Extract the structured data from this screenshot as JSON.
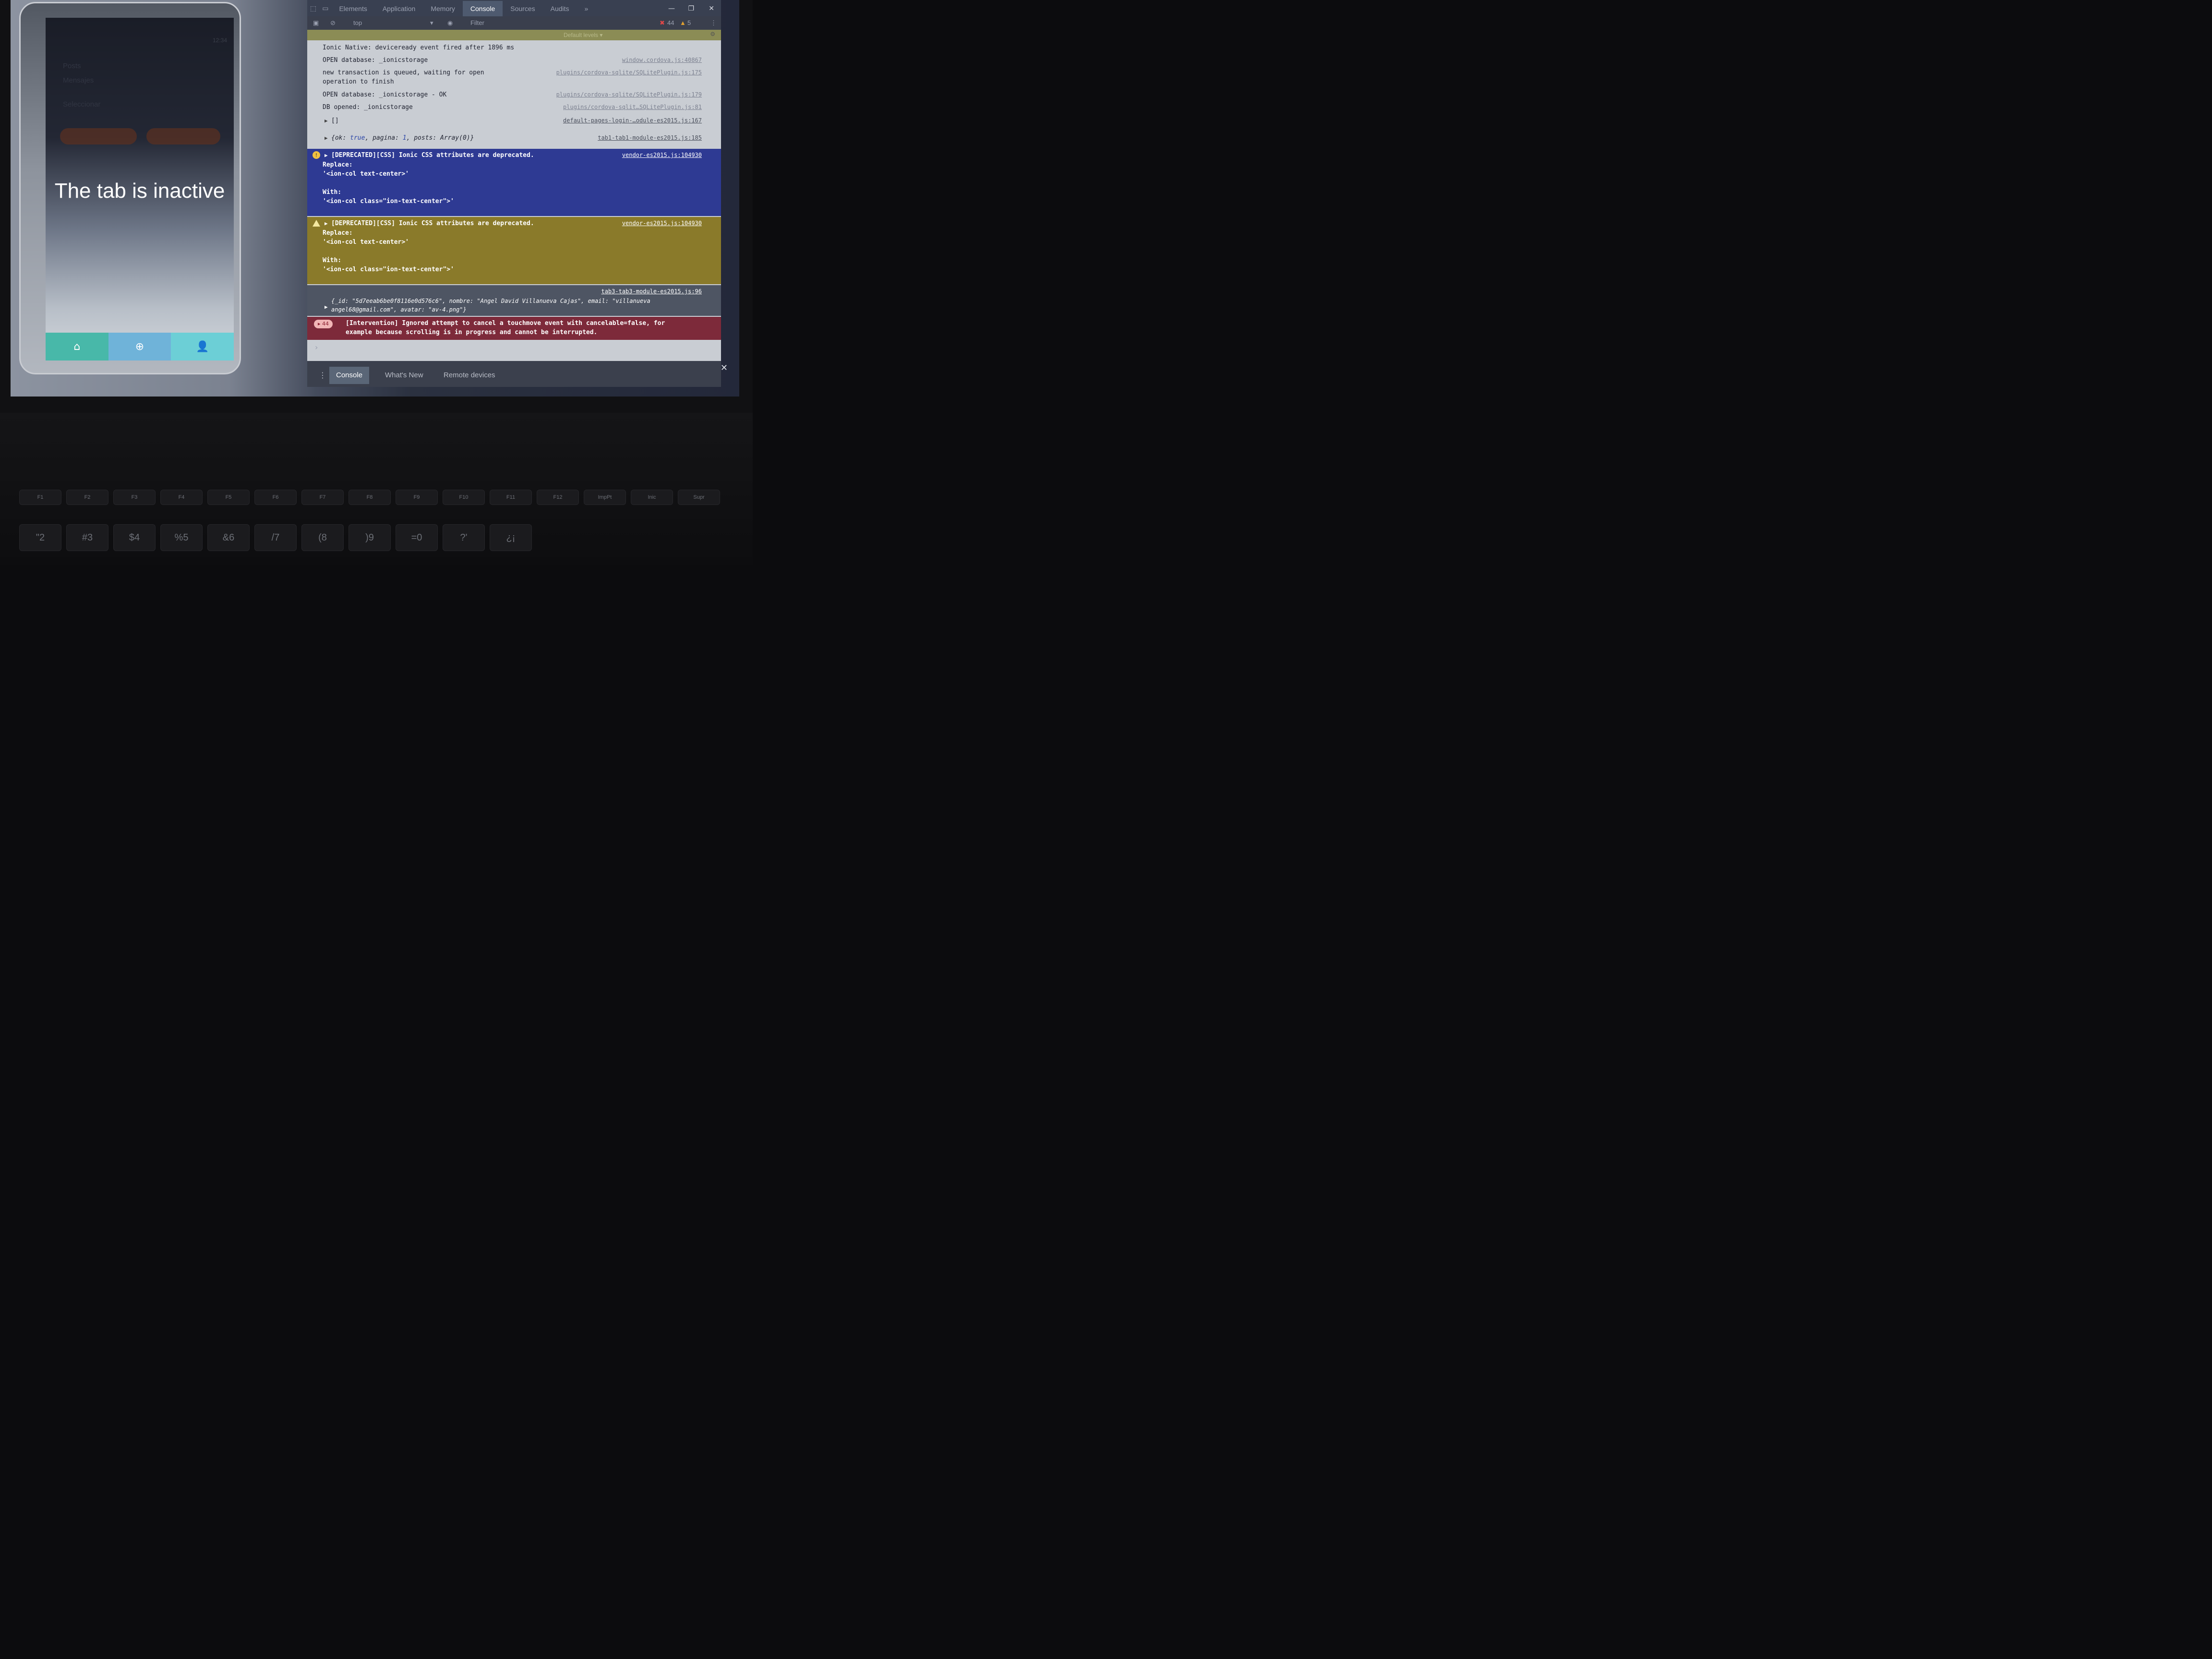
{
  "device": {
    "status": "12:34",
    "lines": [
      "Posts",
      "Mensajes",
      "Seleccionar"
    ],
    "pills": [
      "Button",
      "Button"
    ],
    "main_text": "The tab is inactive",
    "tabs": [
      {
        "icon": "home-icon",
        "glyph": "⌂"
      },
      {
        "icon": "add-circle-icon",
        "glyph": "⊕"
      },
      {
        "icon": "person-icon",
        "glyph": "👤"
      }
    ]
  },
  "devtools": {
    "tabs": [
      "Elements",
      "Application",
      "Memory",
      "Console",
      "Sources",
      "Audits"
    ],
    "active_tab": "Console",
    "more_tabs": "»",
    "toolbar": {
      "context": "top",
      "filter_placeholder": "Filter",
      "levels": "Default levels ▾",
      "error_count": "44",
      "warning_count": "5"
    },
    "console": {
      "lines": [
        {
          "msg": "Ionic Native: deviceready event fired after 1896 ms",
          "src": ""
        },
        {
          "msg": "OPEN database: _ionicstorage",
          "src": "window.cordova.js:40867"
        },
        {
          "msg": "new transaction is queued, waiting for open\noperation to finish",
          "src": "plugins/cordova-sqlite/SQLitePlugin.js:175"
        },
        {
          "msg": "OPEN database: _ionicstorage - OK",
          "src": "plugins/cordova-sqlite/SQLitePlugin.js:179"
        },
        {
          "msg": "DB opened: _ionicstorage",
          "src": "plugins/cordova-sqlit…SQLitePlugin.js:81"
        },
        {
          "msg": "[]",
          "src": "default-pages-login-…odule-es2015.js:167"
        }
      ],
      "ok_line": {
        "prefix": "{ok: ",
        "ok": "true",
        "mid": ", pagina: ",
        "pagina": "1",
        "suffix": ", posts: Array(0)}",
        "src": "tab1-tab1-module-es2015.js:185"
      },
      "warning_blue": {
        "title": "[DEPRECATED][CSS] Ionic CSS attributes are deprecated.",
        "body": "Replace:\n'<ion-col text-center>'\n\nWith:\n'<ion-col class=\"ion-text-center\">'",
        "src": "vendor-es2015.js:104930"
      },
      "warning_yellow": {
        "title": "[DEPRECATED][CSS] Ionic CSS attributes are deprecated.",
        "body": "Replace:\n'<ion-col text-center>'\n\nWith:\n'<ion-col class=\"ion-text-center\">'",
        "src": "vendor-es2015.js:104930"
      },
      "object_line": {
        "src": "tab3-tab3-module-es2015.js:96",
        "text1": "{_id: \"5d7eeab6be0f8116e0d576c6\", nombre: \"Angel David Villanueva Cajas\", email: \"villanueva",
        "text2": "angel68@gmail.com\", avatar: \"av-4.png\"}"
      },
      "error_line": {
        "count": "44",
        "text": "[Intervention] Ignored attempt to cancel a touchmove event with cancelable=false, for\nexample because scrolling is in progress and cannot be interrupted."
      },
      "prompt": "›"
    },
    "drawer": {
      "tabs": [
        "Console",
        "What's New",
        "Remote devices"
      ],
      "active": "Console"
    }
  },
  "keyboard": {
    "fn_row": [
      "F1",
      "F2",
      "F3",
      "F4",
      "F5",
      "F6",
      "F7",
      "F8",
      "F9",
      "F10",
      "F11",
      "F12",
      "ImpPt",
      "Inic",
      "Supr"
    ],
    "num_row": [
      "\"2",
      "#3",
      "$4",
      "%5",
      "&6",
      "/7",
      "(8",
      ")9",
      "=0",
      "?'",
      "¿¡"
    ]
  }
}
